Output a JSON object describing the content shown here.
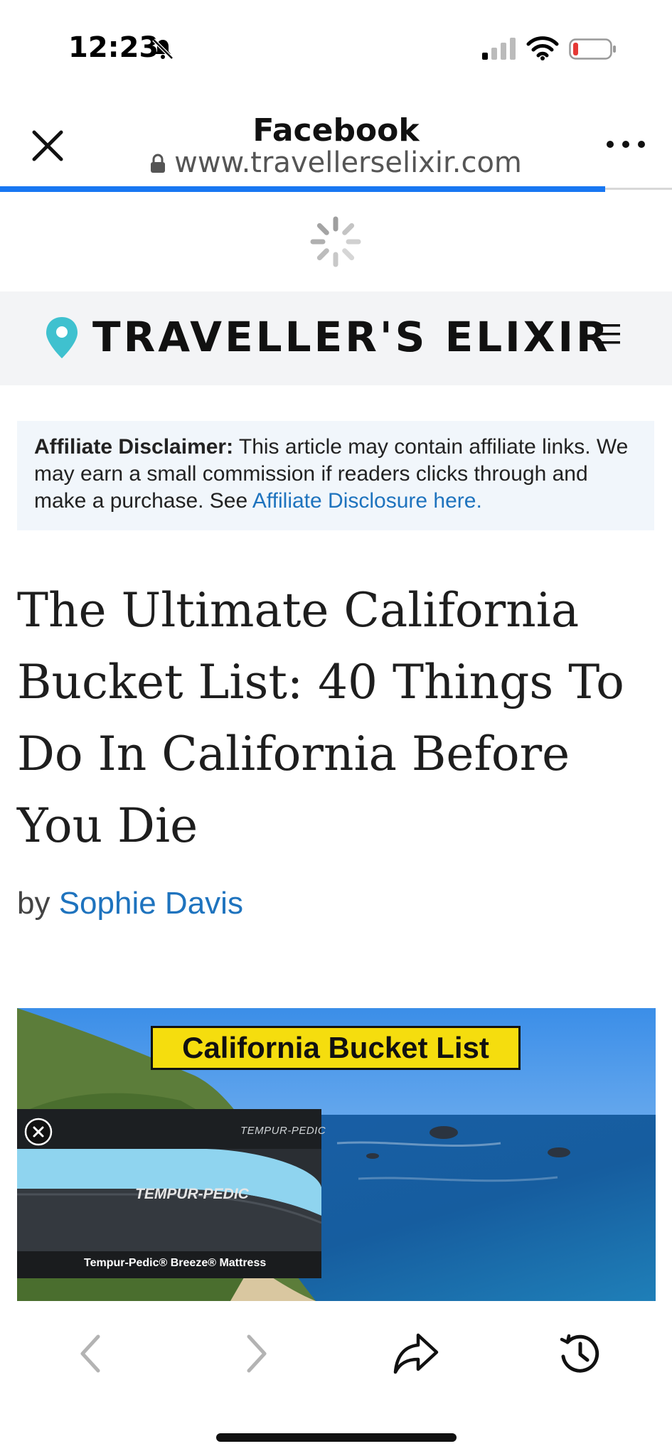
{
  "status_bar": {
    "time": "12:23",
    "icons": [
      "bell-slash-icon",
      "cellular-signal-icon",
      "wifi-icon",
      "battery-low-icon"
    ]
  },
  "browser": {
    "title": "Facebook",
    "url": "www.travellerselixir.com",
    "load_progress": 0.9,
    "accent_color": "#1877f2",
    "icons": [
      "close-icon",
      "lock-icon",
      "more-icon",
      "spinner-icon"
    ]
  },
  "site": {
    "logo_text": "TRAVELLER'S ELIXIR",
    "brand_color": "#3fc1cf",
    "icons": [
      "location-pin-icon",
      "hamburger-menu-icon"
    ]
  },
  "disclaimer": {
    "label": "Affiliate Disclaimer:",
    "text": " This article may contain affiliate links. We may earn a small commission if readers clicks through and make a purchase. See ",
    "link": "Affiliate Disclosure here."
  },
  "article": {
    "title": "The Ultimate California Bucket List: 40 Things To Do In California Before You Die",
    "by": "by ",
    "author": "Sophie Davis",
    "hero_banner": "California Bucket List"
  },
  "ad": {
    "brand": "TEMPUR-PEDIC",
    "logo": "TEMPUR-PEDIC",
    "caption": "Tempur-Pedic® Breeze® Mattress",
    "icons": [
      "close-icon"
    ]
  },
  "toolbar": {
    "icons": [
      "back-chevron-icon",
      "forward-chevron-icon",
      "share-icon",
      "history-icon"
    ]
  }
}
